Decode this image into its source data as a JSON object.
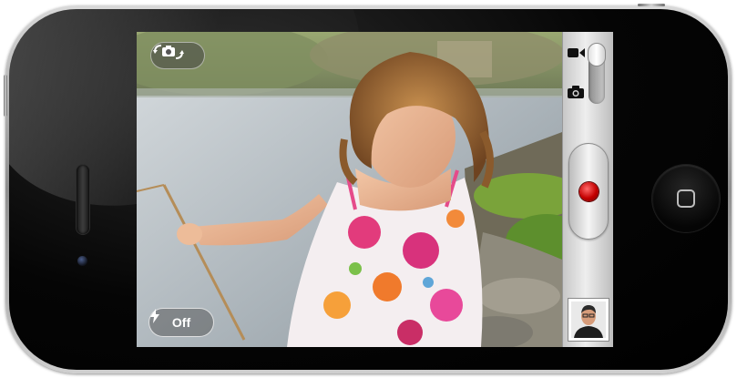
{
  "camera": {
    "flash_label": "Off",
    "flash_icon": "lightning-bolt-icon",
    "switch_camera_icon": "switch-camera-icon",
    "mode_options": [
      "video-camera-icon",
      "camera-icon"
    ],
    "record_icon": "record-dot-icon",
    "thumbnail": "last-capture-thumbnail"
  },
  "colors": {
    "record_red": "#d40000",
    "control_strip": "#d8d8d8"
  }
}
